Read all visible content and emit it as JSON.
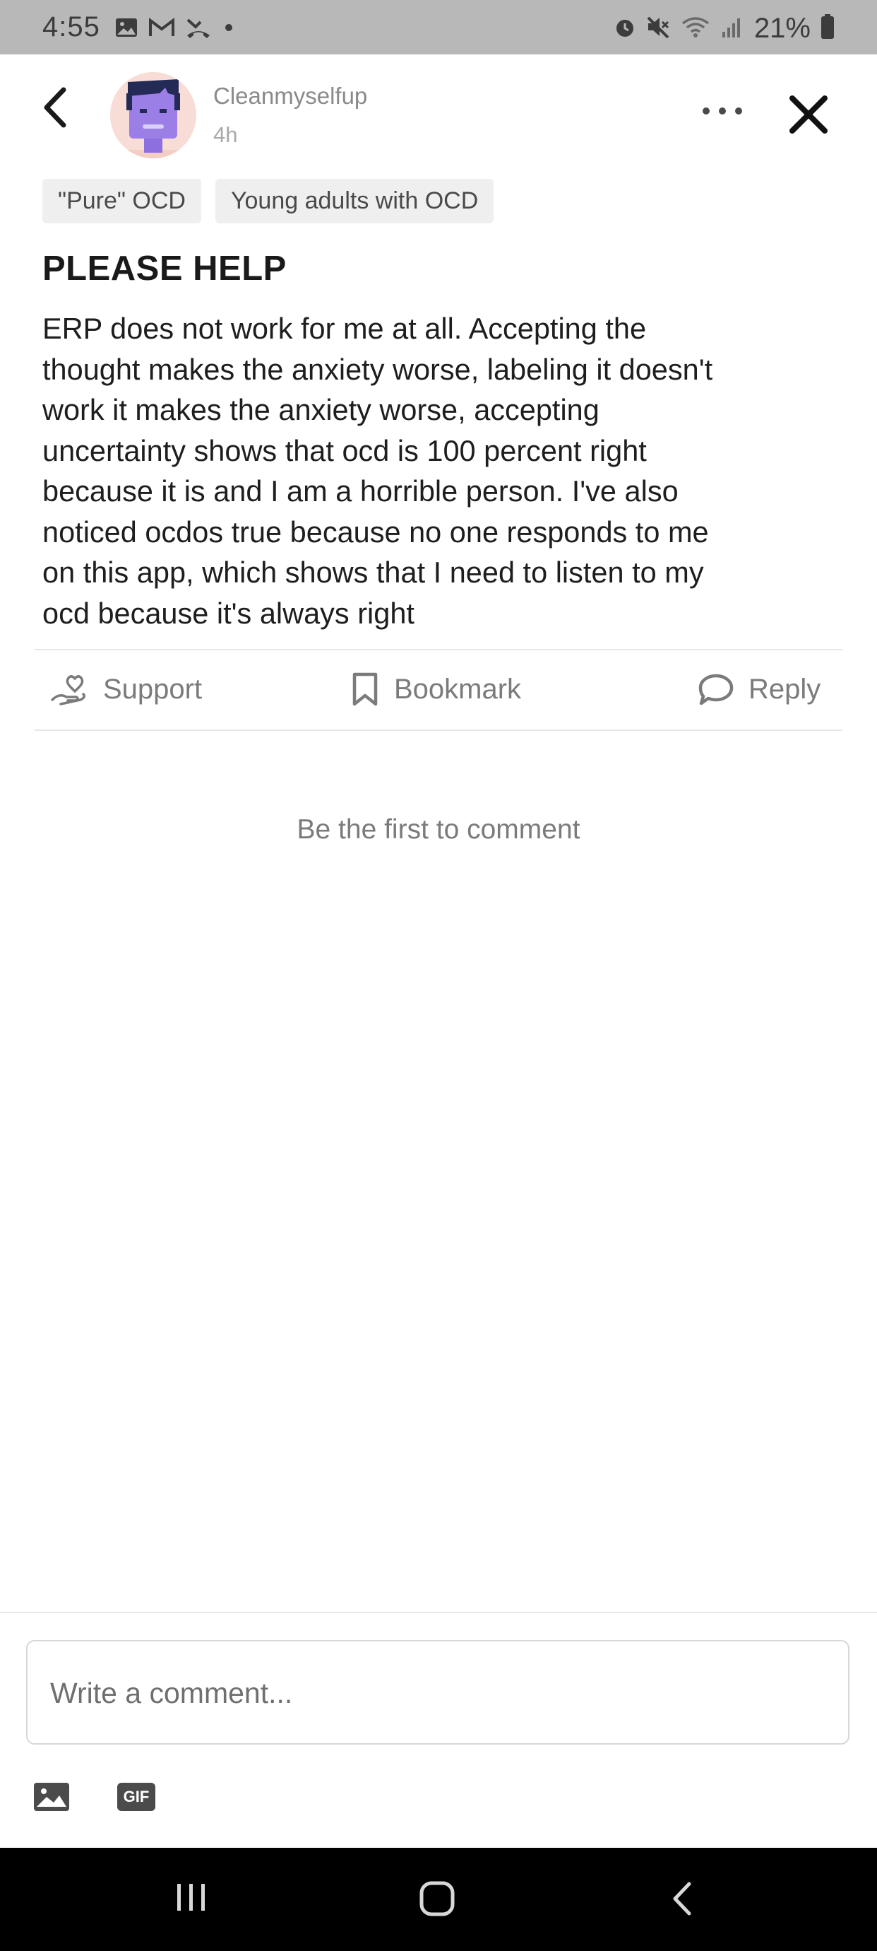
{
  "status_bar": {
    "time": "4:55",
    "battery": "21%",
    "left_icons": [
      "gallery-icon",
      "gmail-icon",
      "missed-call-icon",
      "dot-icon"
    ],
    "right_icons": [
      "alarm-icon",
      "mute-icon",
      "wifi-icon",
      "signal-icon",
      "battery-icon"
    ]
  },
  "header": {
    "username": "Cleanmyselfup",
    "time_ago": "4h"
  },
  "tags": [
    "\"Pure\" OCD",
    "Young adults with OCD"
  ],
  "post": {
    "title": "PLEASE HELP",
    "body_lines": [
      "ERP does not work for me at all. Accepting the",
      "thought makes the anxiety worse, labeling it doesn't",
      "work it makes the anxiety worse, accepting",
      "uncertainty shows that ocd is 100 percent right",
      "because it is and I am a horrible person. I've also",
      "noticed ocdos true because no one responds to me",
      "on this app, which shows that I need to listen to my",
      "ocd because it's always right"
    ]
  },
  "actions": {
    "support": "Support",
    "bookmark": "Bookmark",
    "reply": "Reply"
  },
  "comments": {
    "empty_text": "Be the first to comment"
  },
  "composer": {
    "placeholder": "Write a comment...",
    "gif_label": "GIF"
  },
  "colors": {
    "status_bar_bg": "#b8b8b8",
    "avatar_bg": "#f7ddd6",
    "avatar_face": "#9b7ee6",
    "muted_text": "#7b7b7b",
    "nav_bar_bg": "#000000"
  }
}
